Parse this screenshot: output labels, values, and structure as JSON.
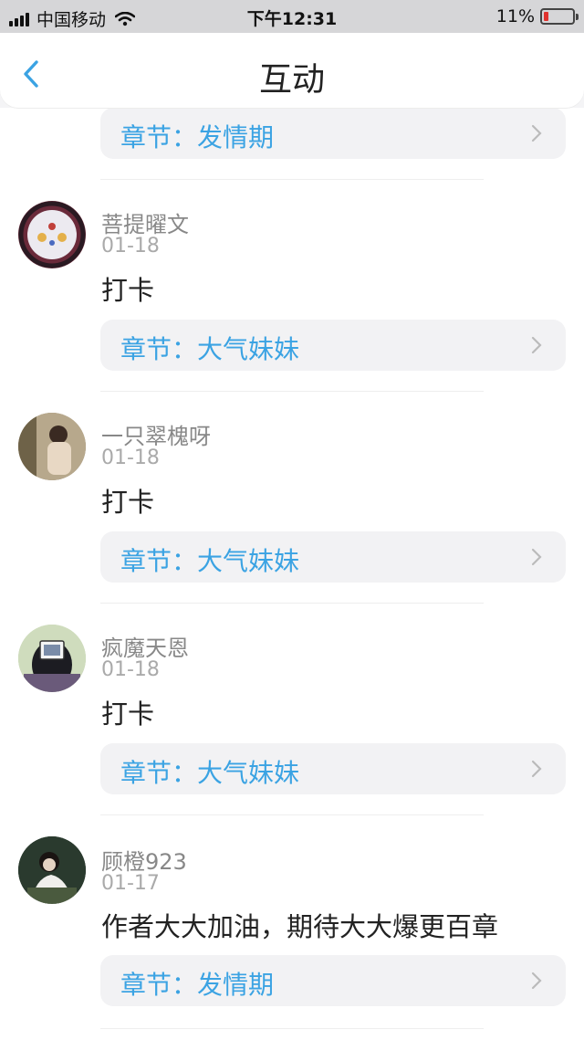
{
  "status_bar": {
    "carrier": "中国移动",
    "time": "下午12:31",
    "battery": "11%",
    "battery_level": 0.11,
    "icons": [
      "signal-icon",
      "wifi-icon",
      "battery-icon"
    ]
  },
  "nav": {
    "title": "互动",
    "back_icon": "chevron-left-icon"
  },
  "colors": {
    "accent": "#3ba3e3",
    "card_bg": "#f2f2f4",
    "battery_low": "#e0332f"
  },
  "feed": {
    "top_chapter": {
      "label": "章节：发情期"
    },
    "items": [
      {
        "username": "菩提曜文",
        "date": "01-18",
        "comment": "打卡",
        "chapter": "章节：大气妹妹"
      },
      {
        "username": "一只翠槐呀",
        "date": "01-18",
        "comment": "打卡",
        "chapter": "章节：大气妹妹"
      },
      {
        "username": "疯魔天恩",
        "date": "01-18",
        "comment": "打卡",
        "chapter": "章节：大气妹妹"
      },
      {
        "username": "顾橙923",
        "date": "01-17",
        "comment": "作者大大加油，期待大大爆更百章",
        "chapter": "章节：发情期"
      }
    ]
  }
}
